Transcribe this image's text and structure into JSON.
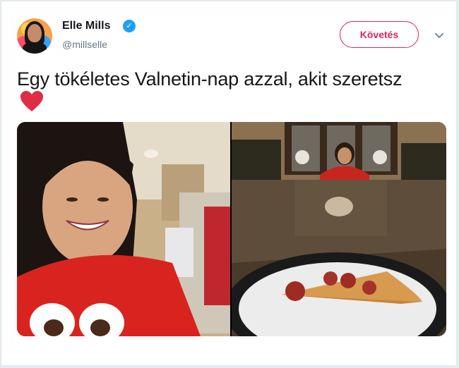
{
  "user": {
    "name": "Elle Mills",
    "handle": "@millselle",
    "verified_icon": "verified-badge-icon",
    "avatar_icon": "profile-avatar"
  },
  "actions": {
    "follow_label": "Követés",
    "menu_icon": "chevron-down-icon"
  },
  "tweet": {
    "text": "Egy tökéletes Valnetin-nap azzal, akit szeretsz",
    "emoji": "red-heart-icon"
  },
  "media": {
    "photos": [
      "selfie-photo",
      "pizza-table-photo"
    ]
  },
  "colors": {
    "accent": "#e0245e",
    "verified": "#1da1f2",
    "text": "#14171a",
    "secondary": "#657786"
  }
}
